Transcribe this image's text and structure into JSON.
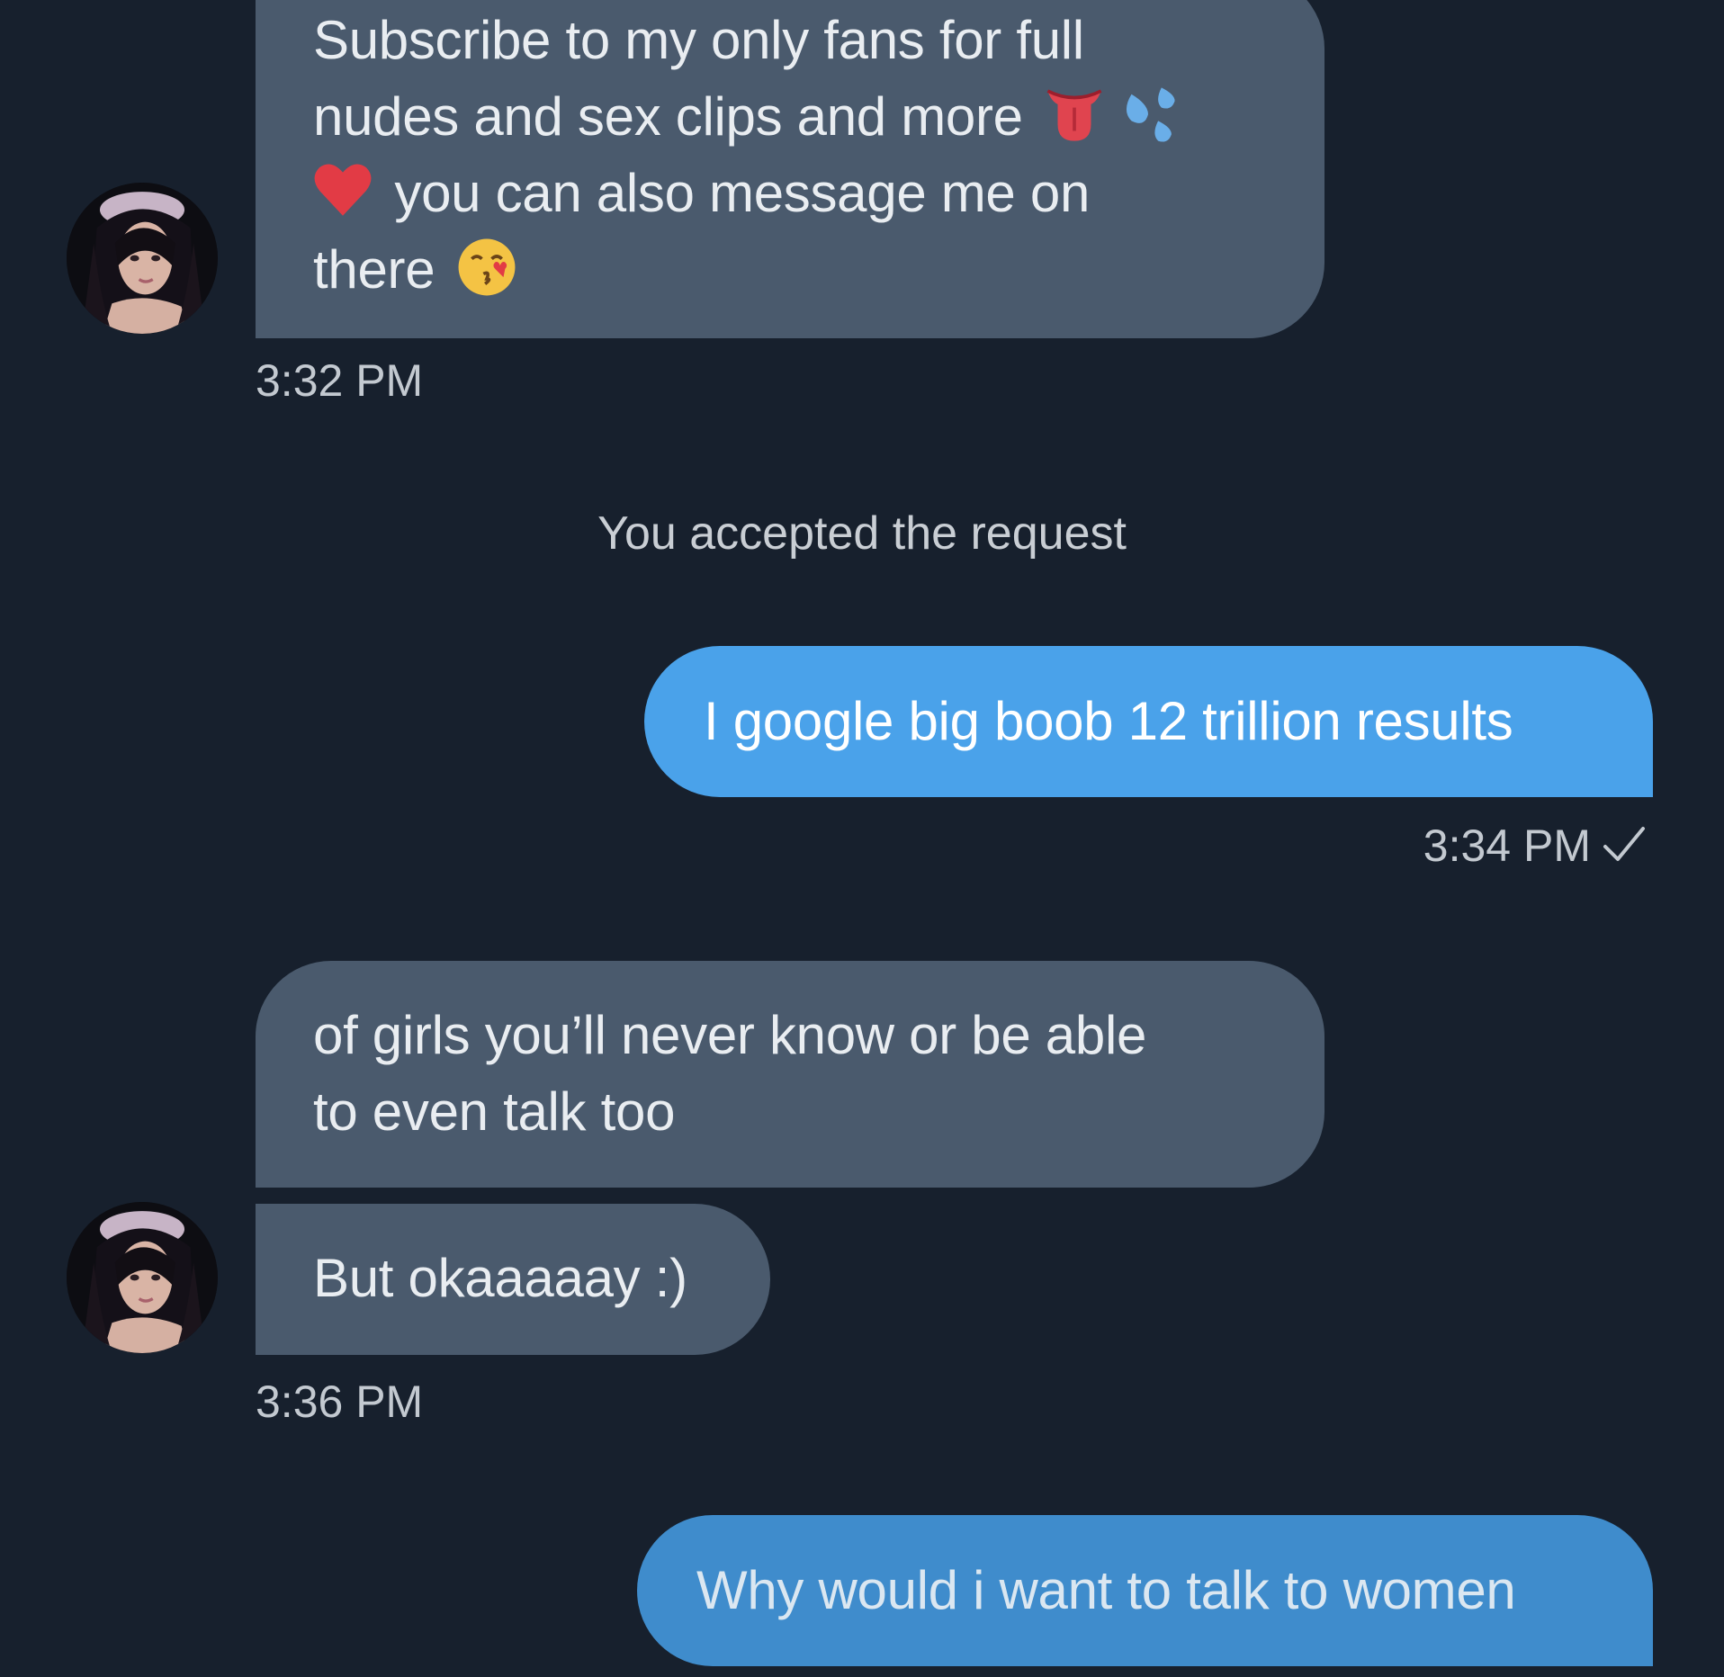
{
  "messages": {
    "m1": {
      "line1": "Subscribe to my only fans for full",
      "line2": "nudes and sex clips and more",
      "line3": "you can also message me on",
      "line4": "there",
      "time": "3:32 PM"
    },
    "system_note": "You accepted the request",
    "m2": {
      "text": "I google big boob 12 trillion results",
      "time": "3:34 PM"
    },
    "m3": {
      "line1": "of girls you’ll never know or be able",
      "line2": "to even talk too"
    },
    "m4": {
      "text": "But okaaaaay :)",
      "time": "3:36 PM"
    },
    "m5": {
      "text": "Why would i want to talk to women"
    }
  },
  "colors": {
    "background": "#17202d",
    "incoming_bubble": "#4a5a6d",
    "outgoing_bubble": "#4aa2ea",
    "timestamp": "#c3c9d0"
  },
  "icons": {
    "tongue": "tongue-emoji-icon",
    "sweat": "sweat-droplets-emoji-icon",
    "heart": "red-heart-emoji-icon",
    "kiss": "face-blowing-kiss-emoji-icon",
    "read": "checkmark-icon"
  }
}
